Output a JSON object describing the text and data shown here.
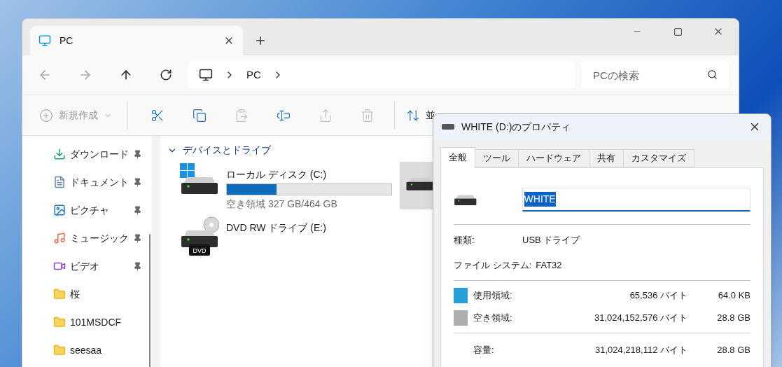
{
  "window": {
    "tab": {
      "title": "PC",
      "selected": true
    }
  },
  "nav": {
    "breadcrumb": [
      "PC"
    ],
    "search": {
      "placeholder": "PCの検索"
    }
  },
  "toolbar": {
    "new": {
      "label": "新規作成",
      "disabled": true
    },
    "actions": [
      {
        "kind": "cut",
        "disabled": false
      },
      {
        "kind": "copy",
        "disabled": false
      },
      {
        "kind": "paste",
        "disabled": true
      },
      {
        "kind": "rename",
        "disabled": false
      },
      {
        "kind": "share",
        "disabled": true
      },
      {
        "kind": "delete",
        "disabled": true
      }
    ],
    "sort": {
      "label": "並"
    }
  },
  "sidebar": {
    "items": [
      {
        "label": "ダウンロード",
        "kind": "download",
        "pinned": true
      },
      {
        "label": "ドキュメント",
        "kind": "document",
        "pinned": true
      },
      {
        "label": "ピクチャ",
        "kind": "picture",
        "pinned": true
      },
      {
        "label": "ミュージック",
        "kind": "music",
        "pinned": true
      },
      {
        "label": "ビデオ",
        "kind": "video",
        "pinned": true
      },
      {
        "label": "桜",
        "kind": "folder",
        "pinned": false
      },
      {
        "label": "101MSDCF",
        "kind": "folder",
        "pinned": false
      },
      {
        "label": "seesaa",
        "kind": "folder",
        "pinned": false
      }
    ]
  },
  "section": {
    "title": "デバイスとドライブ",
    "expanded": true,
    "drives": [
      {
        "name": "ローカル ディスク (C:)",
        "kind": "system",
        "level": 0.3,
        "free": "空き領域 327 GB/464 GB",
        "selected": false
      },
      {
        "kind": "disk",
        "selected": true
      },
      {
        "name": "DVD RW ドライブ (E:)",
        "kind": "dvd",
        "badge": "DVD",
        "selected": false
      }
    ]
  },
  "dialog": {
    "title": "WHITE (D:)のプロパティ",
    "tabs": [
      {
        "label": "全般",
        "selected": true
      },
      {
        "label": "ツール",
        "selected": false
      },
      {
        "label": "ハードウェア",
        "selected": false
      },
      {
        "label": "共有",
        "selected": false
      },
      {
        "label": "カスタマイズ",
        "selected": false
      }
    ],
    "name": "WHITE",
    "info": [
      {
        "label": "種類:",
        "value": "USB ドライブ"
      },
      {
        "label": "ファイル システム:",
        "value": "FAT32"
      }
    ],
    "space": [
      {
        "label": "使用領域:",
        "bytes": "65,536 バイト",
        "size": "64.0 KB",
        "color": "#26a0da"
      },
      {
        "label": "空き領域:",
        "bytes": "31,024,152,576 バイト",
        "size": "28.8 GB",
        "color": "#adadad"
      }
    ],
    "capacity": {
      "label": "容量:",
      "bytes": "31,024,218,112 バイト",
      "size": "28.8 GB"
    }
  }
}
